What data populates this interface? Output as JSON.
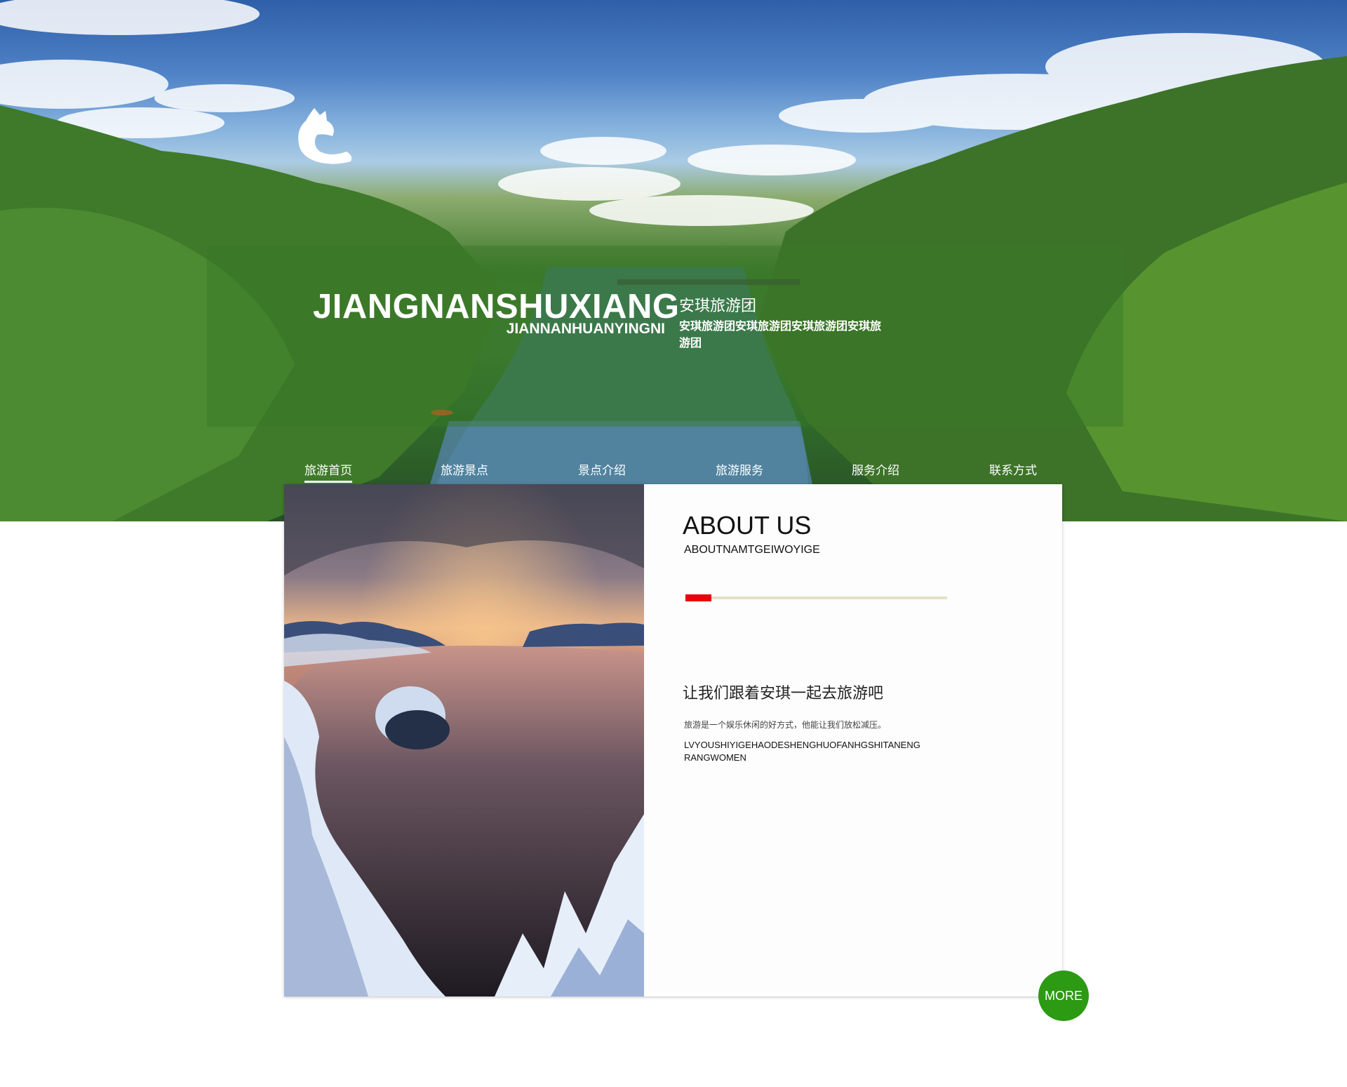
{
  "hero": {
    "title_en": "JIANGNANSHUXIANG",
    "subtitle_en": "JIANNANHUANYINGNI",
    "title_cn": "安琪旅游团",
    "desc_cn": "安琪旅游团安琪旅游团安琪旅游团安琪旅游团"
  },
  "nav": {
    "items": [
      "旅游首页",
      "旅游景点",
      "景点介绍",
      "旅游服务",
      "服务介绍",
      "联系方式"
    ],
    "active_index": 0
  },
  "about": {
    "title": "ABOUT US",
    "subtitle": "ABOUTNAMTGEIWOYIGE",
    "progress_fraction": 0.1,
    "slogan": "让我们跟着安琪一起去旅游吧",
    "intro_cn": "旅游是一个娱乐休闲的好方式，他能让我们放松减压。",
    "intro_en": "LVYOUSHIYIGEHAODESHENGHUOFANHGSHITANENGRANGWOMEN",
    "more_label": "MORE"
  },
  "colors": {
    "accent_green": "#2c9a12",
    "progress_red": "#e8000e",
    "progress_track": "#e5e0c4"
  },
  "icons": {
    "logo": "fox-logo-icon"
  }
}
